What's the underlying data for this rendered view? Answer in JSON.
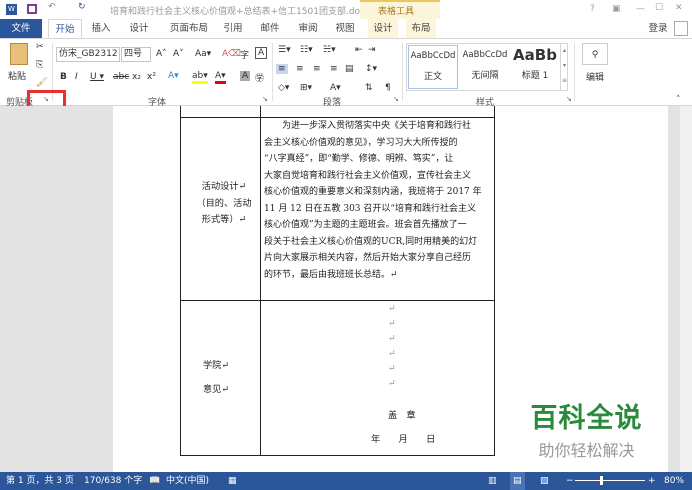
{
  "titlebar": {
    "title": "培育和践行社会主义核心价值观+总结表+信工1501团支部.doc...",
    "context_tab": "表格工具",
    "controls": [
      "?",
      "▣",
      "—",
      "☐",
      "✕"
    ]
  },
  "tabs": {
    "file": "文件",
    "items": [
      "开始",
      "插入",
      "设计",
      "页面布局",
      "引用",
      "邮件",
      "审阅",
      "视图",
      "设计",
      "布局"
    ],
    "login": "登录"
  },
  "ribbon": {
    "paste": "粘贴",
    "font_name": "仿宋_GB2312",
    "font_size": "四号",
    "group_labels": [
      "剪贴板",
      "字体",
      "段落",
      "样式"
    ],
    "styles": [
      {
        "preview": "AaBbCcDd",
        "name": "正文"
      },
      {
        "preview": "AaBbCcDd",
        "name": "无间隔"
      },
      {
        "preview": "AaBb",
        "name": "标题 1"
      }
    ],
    "edit": "编辑"
  },
  "document": {
    "row1_label": [
      "活动设计↵",
      "（目的、活动",
      "形式等）↵"
    ],
    "row1_content": [
      "　　为进一步深入贯彻落实中央《关于培育和践行社",
      "会主义核心价值观的意见》，学习习大大所传授的",
      "“八字真经”，即“勤学、修德、明辨、笃实”，让",
      "大家自觉培育和践行社会主义价值观，宣传社会主义",
      "核心价值观的重要意义和深刻内涵，我班将于 2017 年",
      "11 月 12 日在五教 303 召开以“培育和践行社会主义",
      "核心价值观”为主题的主题班会。班会首先播放了一",
      "段关于社会主义核心价值观的UCR,同时用精美的幻灯",
      "片向大家展示相关内容，然后开始大家分享自己经历",
      "的环节，最后由我班班长总结。↵"
    ],
    "row2_label": [
      "学院↵",
      "意见↵"
    ],
    "seal": "盖　章",
    "date": "年　　月　　日"
  },
  "watermark": {
    "title": "百科全说",
    "subtitle": "助你轻松解决"
  },
  "status": {
    "page": "第 1 页，共 3 页",
    "words": "170/638 个字",
    "lang": "中文(中国)",
    "zoom": "80%"
  },
  "colors": {
    "accent": "#2b579a",
    "highlight": "#e8312f"
  }
}
